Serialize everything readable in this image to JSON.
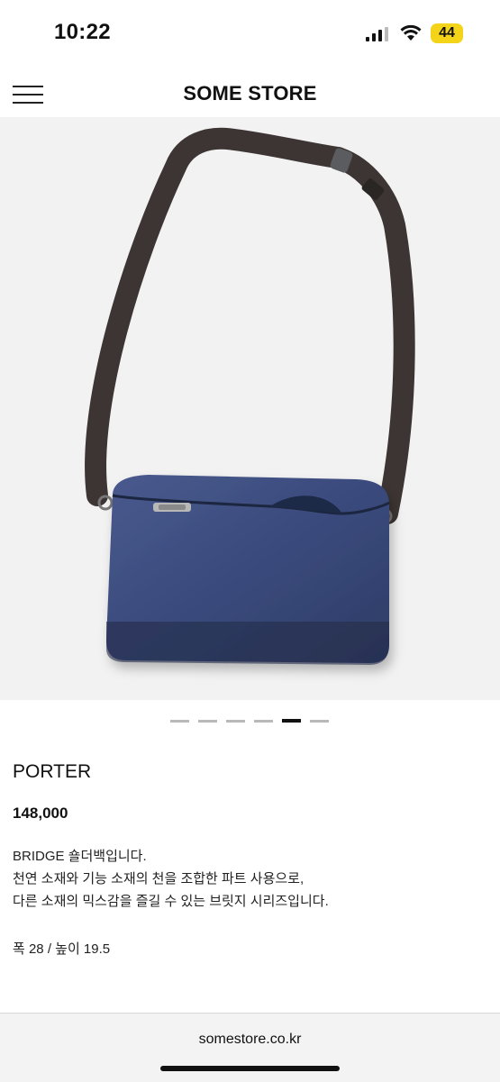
{
  "status_bar": {
    "time": "10:22",
    "battery": "44"
  },
  "header": {
    "title": "SOME STORE"
  },
  "gallery": {
    "image_alt": "navy shoulder bag with dark brown strap",
    "slide_count": 6,
    "active_index": 4
  },
  "product": {
    "brand": "PORTER",
    "price": "148,000",
    "description": [
      "BRIDGE 숄더백입니다.",
      "천연 소재와 기능 소재의 천을 조합한 파트 사용으로,",
      "다른 소재의 믹스감을 즐길 수 있는 브릿지 시리즈입니다."
    ],
    "size": "폭 28 / 높이 19.5"
  },
  "footer": {
    "url": "somestore.co.kr"
  },
  "colors": {
    "battery": "#f4d418",
    "background": "#ffffff",
    "image_bg": "#f2f2f2",
    "bag": "#3a4a7a",
    "strap": "#3d3533"
  }
}
